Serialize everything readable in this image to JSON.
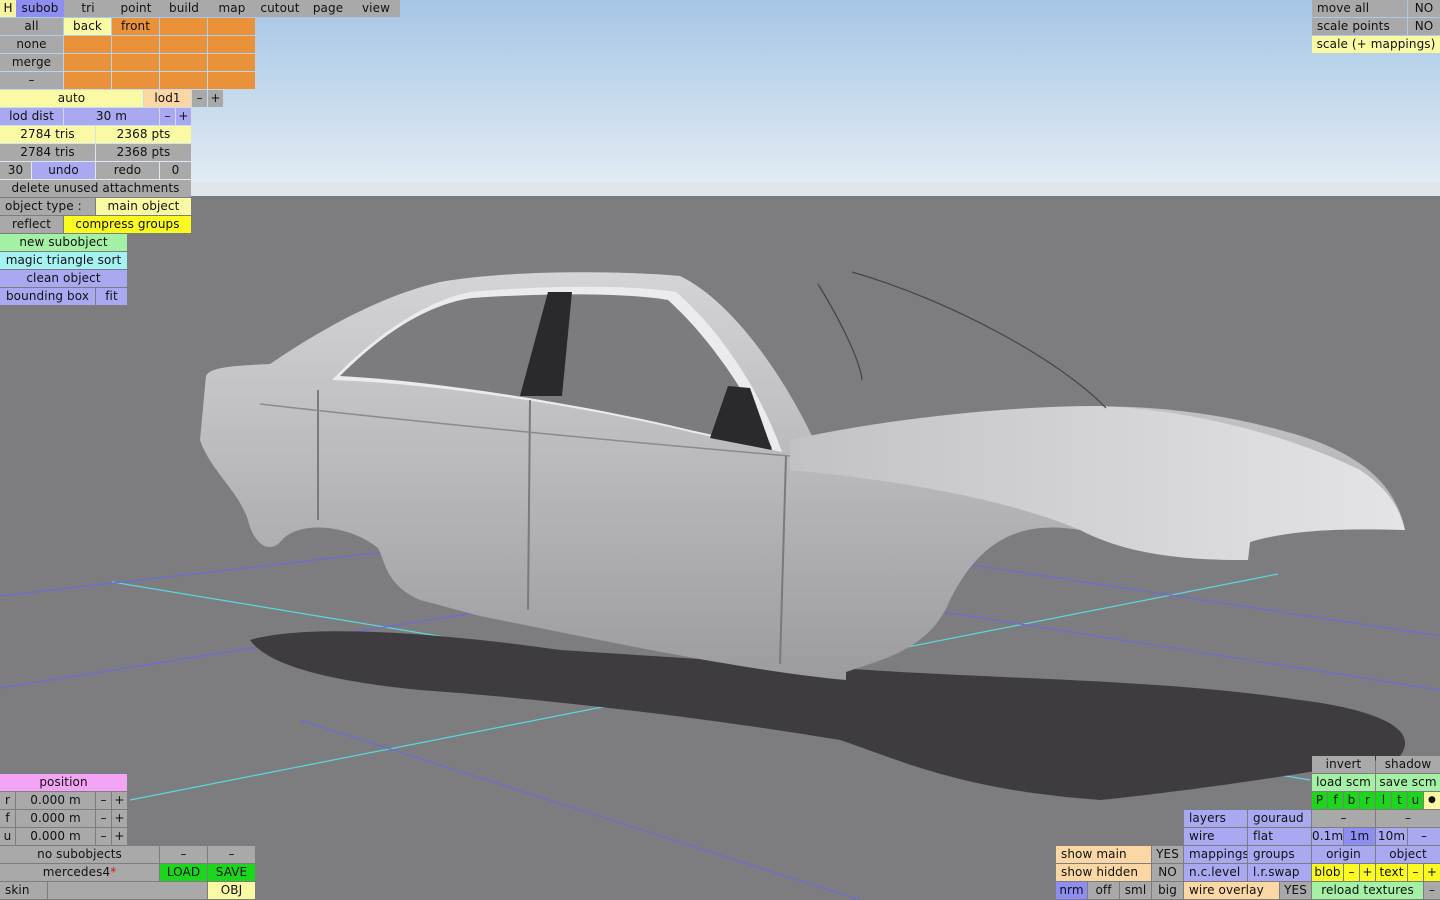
{
  "top_menu": {
    "h": "H",
    "tabs": [
      "subob",
      "tri",
      "point",
      "build",
      "map",
      "cutout",
      "page",
      "view"
    ]
  },
  "selection": {
    "all": "all",
    "back": "back",
    "front": "front",
    "none": "none",
    "merge": "merge",
    "dash": "–"
  },
  "lod": {
    "auto": "auto",
    "lod1": "lod1",
    "minus": "–",
    "plus": "+",
    "dist_label": "lod dist",
    "dist_value": "30 m"
  },
  "stats": {
    "tris_1": "2784 tris",
    "pts_1": "2368 pts",
    "tris_2": "2784 tris",
    "pts_2": "2368 pts"
  },
  "history": {
    "count": "30",
    "undo": "undo",
    "redo": "redo",
    "redo_count": "0"
  },
  "actions": {
    "delete_unused": "delete unused attachments",
    "object_type_label": "object type :",
    "object_type_value": "main object",
    "reflect": "reflect",
    "compress_groups": "compress groups",
    "new_subobject": "new subobject",
    "magic_sort": "magic triangle sort",
    "clean_object": "clean object",
    "bounding_box": "bounding box",
    "fit": "fit"
  },
  "top_right": {
    "move_all": "move all",
    "move_all_value": "NO",
    "scale_points": "scale points",
    "scale_points_value": "NO",
    "scale_mappings": "scale (+ mappings)"
  },
  "position": {
    "title": "position",
    "rows": [
      {
        "axis": "r",
        "value": "0.000 m"
      },
      {
        "axis": "f",
        "value": "0.000 m"
      },
      {
        "axis": "u",
        "value": "0.000 m"
      }
    ],
    "minus": "–",
    "plus": "+"
  },
  "bottom_left": {
    "no_subobjects": "no subobjects",
    "dash": "–",
    "filename": "mercedes4",
    "modified_mark": "*",
    "load": "LOAD",
    "save": "SAVE",
    "skin": "skin",
    "obj": "OBJ"
  },
  "bottom_mid": {
    "show_main": "show main",
    "show_main_value": "YES",
    "show_hidden": "show hidden",
    "show_hidden_value": "NO",
    "nrm": "nrm",
    "off": "off",
    "sml": "sml",
    "big": "big"
  },
  "render": {
    "layers": "layers",
    "gouraud": "gouraud",
    "wire": "wire",
    "flat": "flat",
    "mappings": "mappings",
    "groups": "groups",
    "nc_level": "n.c.level",
    "lr_swap": "l.r.swap",
    "wire_overlay": "wire overlay",
    "wire_overlay_value": "YES"
  },
  "bottom_right": {
    "invert": "invert",
    "shadow": "shadow",
    "load_scm": "load scm",
    "save_scm": "save scm",
    "flags": [
      "P",
      "f",
      "b",
      "r",
      "l",
      "t",
      "u"
    ],
    "dot": "●",
    "dash": "–",
    "grid_01": "0.1m",
    "grid_1": "1m",
    "grid_10": "10m",
    "origin": "origin",
    "object": "object",
    "blob": "blob",
    "minus": "–",
    "plus": "+",
    "text": "text",
    "reload_textures": "reload textures"
  }
}
